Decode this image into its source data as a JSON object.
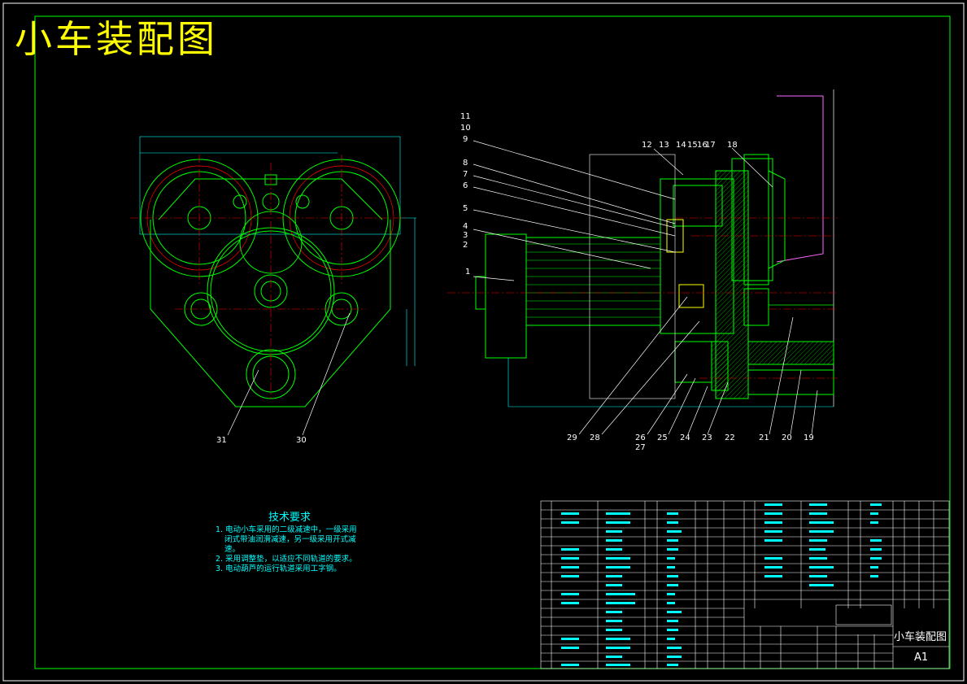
{
  "title": "小车装配图",
  "colors": {
    "background": "#000000",
    "frame": "#00ff00",
    "title": "#ffff00",
    "annotation": "#00ffff",
    "centerline": "#ff0000",
    "part": "#00ff00",
    "text": "#ffffff"
  },
  "part_labels": {
    "left_view": [
      "31",
      "30"
    ],
    "right_top": [
      "11",
      "10",
      "9",
      "8",
      "7",
      "6",
      "5",
      "4",
      "3",
      "2",
      "1"
    ],
    "right_header": [
      "12",
      "13",
      "14",
      "15",
      "16",
      "17",
      "18"
    ],
    "right_bottom": [
      "29",
      "28",
      "26",
      "27",
      "25",
      "24",
      "23",
      "22",
      "21",
      "20",
      "19"
    ]
  },
  "tech": {
    "heading": "技术要求",
    "lines": [
      "1. 电动小车采用的二级减速中，一级采用",
      "闭式带油润滑减速，另一级采用开式减",
      "速。",
      "2. 采用调整垫，以适应不同轨道的要求。",
      "3. 电动葫芦的运行轨道采用工字钢。"
    ]
  },
  "title_block": {
    "drawing_name": "小车装配图",
    "sheet_size": "A1"
  }
}
